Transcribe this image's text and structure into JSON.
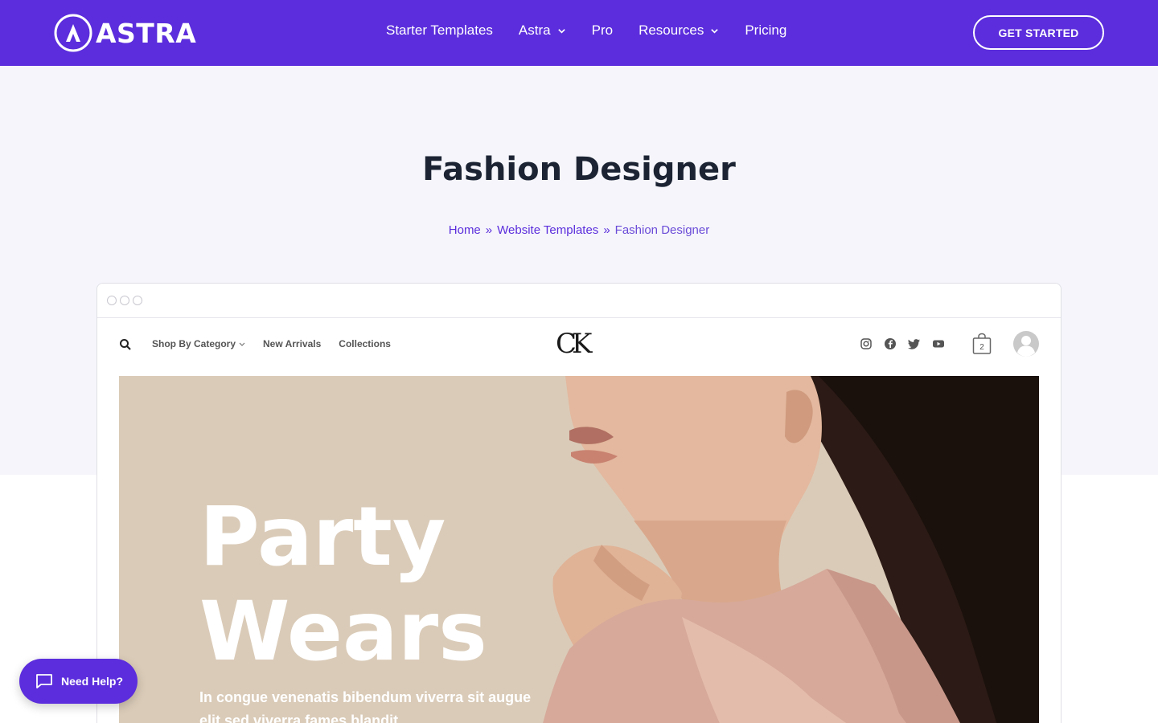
{
  "header": {
    "logo_text": "ASTRA",
    "nav": [
      {
        "label": "Starter Templates",
        "has_dropdown": false
      },
      {
        "label": "Astra",
        "has_dropdown": true
      },
      {
        "label": "Pro",
        "has_dropdown": false
      },
      {
        "label": "Resources",
        "has_dropdown": true
      },
      {
        "label": "Pricing",
        "has_dropdown": false
      }
    ],
    "cta_label": "GET STARTED"
  },
  "page": {
    "title": "Fashion Designer",
    "breadcrumb": [
      "Home",
      "Website Templates",
      "Fashion Designer"
    ],
    "breadcrumb_separator": "»"
  },
  "preview": {
    "nav": [
      "Shop By Category",
      "New Arrivals",
      "Collections"
    ],
    "logo_text": "CK",
    "social_icons": [
      "instagram-icon",
      "facebook-icon",
      "twitter-icon",
      "youtube-icon"
    ],
    "cart_count": "2",
    "hero_line_1": "Party",
    "hero_line_2": "Wears",
    "hero_subtitle": "In congue venenatis bibendum viverra sit augue elit sed viverra fames blandit"
  },
  "help_label": "Need Help?",
  "colors": {
    "brand": "#5b2ddc",
    "hero_background": "#f5f5fb",
    "preview_hero": "#dacbb8",
    "title": "#1c2433"
  }
}
